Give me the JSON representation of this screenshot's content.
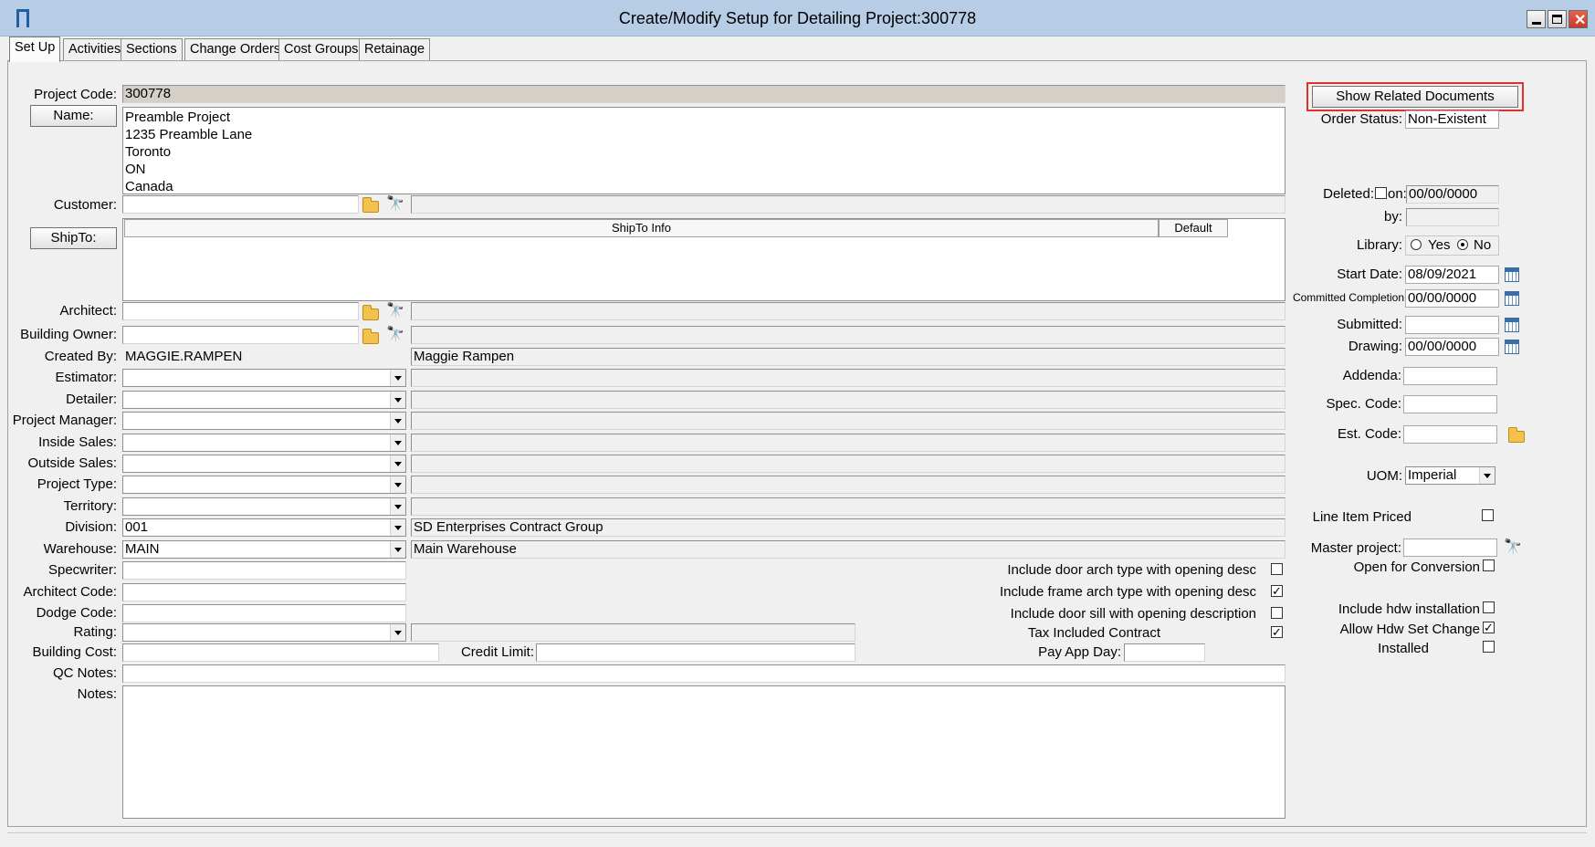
{
  "window": {
    "title": "Create/Modify Setup for Detailing Project:300778",
    "minimize_icon": "minimize-icon",
    "maximize_icon": "maximize-icon",
    "close_icon": "close-icon"
  },
  "tabs": [
    "Set Up",
    "Activities",
    "Sections",
    "Change Orders",
    "Cost Groups",
    "Retainage"
  ],
  "form": {
    "project_code_label": "Project Code:",
    "project_code": "300778",
    "name_button": "Name:",
    "name_lines": [
      "Preamble Project",
      "1235 Preamble Lane",
      "Toronto",
      "ON",
      "Canada"
    ],
    "customer_label": "Customer:",
    "shipto_button": "ShipTo:",
    "shipto_col_info": "ShipTo Info",
    "shipto_col_default": "Default",
    "architect_label": "Architect:",
    "building_owner_label": "Building Owner:",
    "created_by_label": "Created By:",
    "created_by_code": "MAGGIE.RAMPEN",
    "created_by_name": "Maggie Rampen",
    "estimator_label": "Estimator:",
    "detailer_label": "Detailer:",
    "project_manager_label": "Project Manager:",
    "inside_sales_label": "Inside Sales:",
    "outside_sales_label": "Outside Sales:",
    "project_type_label": "Project Type:",
    "territory_label": "Territory:",
    "division_label": "Division:",
    "division_code": "001",
    "division_name": "SD Enterprises Contract Group",
    "warehouse_label": "Warehouse:",
    "warehouse_code": "MAIN",
    "warehouse_name": "Main Warehouse",
    "specwriter_label": "Specwriter:",
    "architect_code_label": "Architect Code:",
    "dodge_code_label": "Dodge Code:",
    "rating_label": "Rating:",
    "building_cost_label": "Building Cost:",
    "credit_limit_label": "Credit Limit:",
    "pay_app_day_label": "Pay App Day:",
    "qc_notes_label": "QC Notes:",
    "notes_label": "Notes:",
    "opt_door_arch": "Include door arch type with opening desc",
    "opt_door_arch_checked": false,
    "opt_frame_arch": "Include frame arch type with opening desc",
    "opt_frame_arch_checked": true,
    "opt_door_sill": "Include door sill with opening description",
    "opt_door_sill_checked": false,
    "opt_tax_included": "Tax Included Contract",
    "opt_tax_included_checked": true
  },
  "right": {
    "show_related_button": "Show Related Documents",
    "order_status_label": "Order Status:",
    "order_status": "Non-Existent",
    "deleted_label": "Deleted:",
    "deleted_checked": false,
    "on_label": "on:",
    "deleted_on": "00/00/0000",
    "by_label": "by:",
    "deleted_by": "",
    "library_label": "Library:",
    "library_yes": "Yes",
    "library_no": "No",
    "library_value": "No",
    "start_date_label": "Start Date:",
    "start_date": "08/09/2021",
    "committed_completion_label": "Committed Completion",
    "committed_completion": "00/00/0000",
    "submitted_label": "Submitted:",
    "submitted": "",
    "drawing_label": "Drawing:",
    "drawing": "00/00/0000",
    "addenda_label": "Addenda:",
    "spec_code_label": "Spec. Code:",
    "est_code_label": "Est. Code:",
    "uom_label": "UOM:",
    "uom": "Imperial",
    "line_item_priced_label": "Line Item Priced",
    "line_item_priced_checked": false,
    "master_project_label": "Master project:",
    "open_for_conversion_label": "Open for Conversion",
    "open_for_conversion_checked": false,
    "include_hdw_label": "Include hdw installation",
    "include_hdw_checked": false,
    "allow_hdw_label": "Allow Hdw Set Change",
    "allow_hdw_checked": true,
    "installed_label": "Installed",
    "installed_checked": false
  },
  "colors": {
    "titlebar": "#b7cde6",
    "highlight": "#e03131",
    "panel": "#f0f0f0"
  }
}
